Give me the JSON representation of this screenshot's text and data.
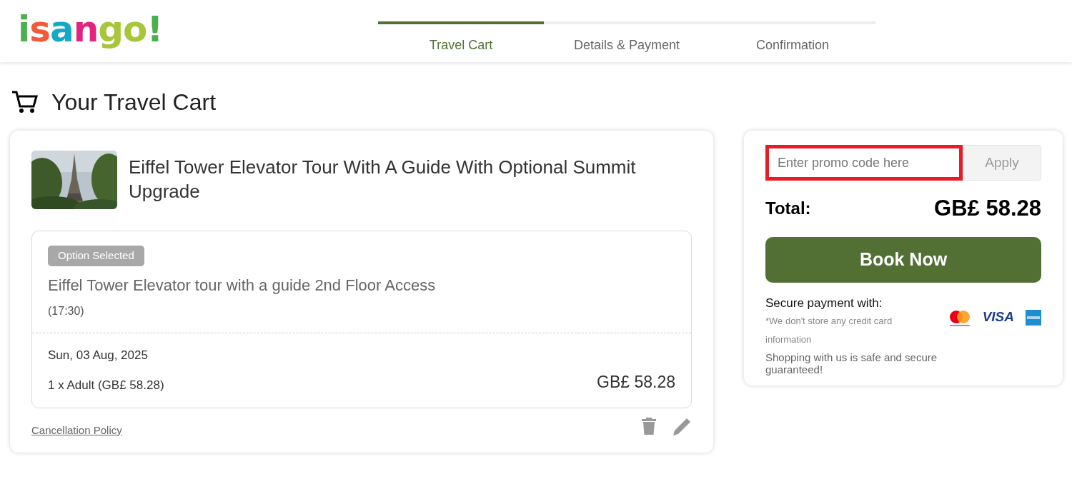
{
  "logo": [
    {
      "letter": "i",
      "color": "#4caf50"
    },
    {
      "letter": "s",
      "color": "#f15a3a"
    },
    {
      "letter": "a",
      "color": "#16a9c7"
    },
    {
      "letter": "n",
      "color": "#e3237f"
    },
    {
      "letter": "g",
      "color": "#a8c639"
    },
    {
      "letter": "o",
      "color": "#a8c639"
    },
    {
      "letter": "!",
      "color": "#4caf50"
    }
  ],
  "steps": [
    {
      "label": "Travel Cart",
      "selected": true
    },
    {
      "label": "Details & Payment",
      "selected": false
    },
    {
      "label": "Confirmation",
      "selected": false
    }
  ],
  "page_title": "Your Travel Cart",
  "cart_item": {
    "title": "Eiffel Tower Elevator Tour With A Guide With Optional Summit Upgrade",
    "badge": "Option Selected",
    "option": "Eiffel Tower Elevator tour with a guide 2nd Floor Access",
    "time": "(17:30)",
    "date": "Sun, 03 Aug, 2025",
    "tickets": "1 x Adult (GB£ 58.28)",
    "price": "GB£ 58.28",
    "cancellation_link": "Cancellation Policy"
  },
  "summary": {
    "promo": {
      "placeholder": "Enter promo code here",
      "highlighted": true
    },
    "apply_button": "Apply",
    "total_label": "Total:",
    "total": "GB£ 58.28",
    "book_button": "Book Now",
    "secure_label": "Secure payment with:",
    "storage_note": "*We don't store any credit card information",
    "safety_note": "Shopping with us is safe and secure guaranteed!",
    "payment_methods": [
      {
        "kind": "mastercard"
      },
      {
        "kind": "visa",
        "label": "VISA"
      },
      {
        "kind": "amex"
      }
    ]
  }
}
